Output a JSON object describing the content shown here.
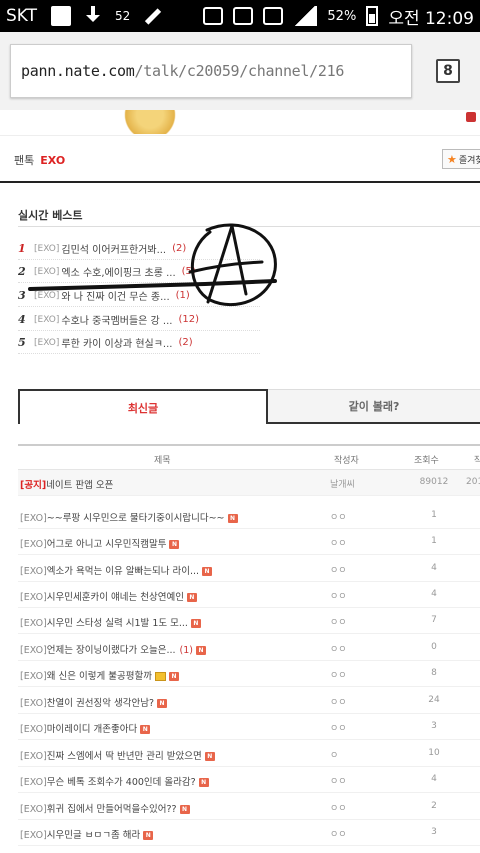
{
  "status_bar": {
    "carrier": "SKT",
    "notification_count": "52",
    "battery_percent": "52%",
    "time": "오전 12:09"
  },
  "browser": {
    "url_domain": "pann.nate.com",
    "url_path": "/talk/c20059/channel/216",
    "tab_count": "8"
  },
  "channel": {
    "section": "팬톡",
    "name": "EXO",
    "favorite_label": "즐겨찾"
  },
  "best": {
    "title": "실시간 베스트",
    "items": [
      {
        "rank": "1",
        "tag": "[EXO]",
        "text": "김민석 이어커프한거봐...",
        "count": "(2)"
      },
      {
        "rank": "2",
        "tag": "[EXO]",
        "text": "엑소 수호,에이핑크 초롱 ...",
        "count": "(5)"
      },
      {
        "rank": "3",
        "tag": "[EXO]",
        "text": "와 나 진짜 이건 무슨 종...",
        "count": "(1)"
      },
      {
        "rank": "4",
        "tag": "[EXO]",
        "text": "수호나 중국멤버들은 강 ...",
        "count": "(12)"
      },
      {
        "rank": "5",
        "tag": "[EXO]",
        "text": "루한 카이 이상과 현실ㅋ...",
        "count": "(2)"
      }
    ]
  },
  "tabs": {
    "latest": "최신글",
    "together": "같이 볼래?"
  },
  "table": {
    "headers": {
      "title": "제목",
      "author": "작성자",
      "views": "조회수",
      "date": "작"
    },
    "notice": {
      "tag": "[공지]",
      "text": "네이트 판앱 오픈",
      "author": "날개씨",
      "views": "89012",
      "date": "201"
    },
    "rows": [
      {
        "tag": "[EXO]",
        "text": "~~루팡 시우민으로 물타기중이시랍니다~~",
        "comments": "",
        "author": "ㅇㅇ",
        "views": "1"
      },
      {
        "tag": "[EXO]",
        "text": "어그로 아니고 시우민직캠말투",
        "comments": "",
        "author": "ㅇㅇ",
        "views": "1"
      },
      {
        "tag": "[EXO]",
        "text": "엑소가 욕먹는 이유 알빠는되나 라이...",
        "comments": "",
        "author": "ㅇㅇ",
        "views": "4"
      },
      {
        "tag": "[EXO]",
        "text": "시우민세훈카이 얘네는 천상연예인",
        "comments": "",
        "author": "ㅇㅇ",
        "views": "4"
      },
      {
        "tag": "[EXO]",
        "text": "시우민 스타성 실력 시1발 1도 모...",
        "comments": "",
        "author": "ㅇㅇ",
        "views": "7"
      },
      {
        "tag": "[EXO]",
        "text": "언제는 장이닝이랬다가 오늘은...",
        "comments": "(1)",
        "author": "ㅇㅇ",
        "views": "0"
      },
      {
        "tag": "[EXO]",
        "text": "왜 신은 이렇게 불공평할까",
        "comments": "",
        "author": "ㅇㅇ",
        "views": "8"
      },
      {
        "tag": "[EXO]",
        "text": "찬열이 권선징악 생각안남?",
        "comments": "",
        "author": "ㅇㅇ",
        "views": "24"
      },
      {
        "tag": "[EXO]",
        "text": "마이레이디 개존좋아다",
        "comments": "",
        "author": "ㅇㅇ",
        "views": "3"
      },
      {
        "tag": "[EXO]",
        "text": "진짜 스엠에서 딱 반년만 관리 받았으면",
        "comments": "",
        "author": "ㅇ",
        "views": "10"
      },
      {
        "tag": "[EXO]",
        "text": "무슨 베톡 조회수가 400인데 올라감?",
        "comments": "",
        "author": "ㅇㅇ",
        "views": "4"
      },
      {
        "tag": "[EXO]",
        "text": "휘귀 집에서 만들어먹을수있어??",
        "comments": "",
        "author": "ㅇㅇ",
        "views": "2"
      },
      {
        "tag": "[EXO]",
        "text": "시우민글 ㅂㅁㄱ좀 해라",
        "comments": "",
        "author": "ㅇㅇ",
        "views": "3"
      }
    ]
  },
  "badge_new": "N",
  "colors": {
    "accent": "#dd2222",
    "tab_active_text": "#dd3333"
  }
}
